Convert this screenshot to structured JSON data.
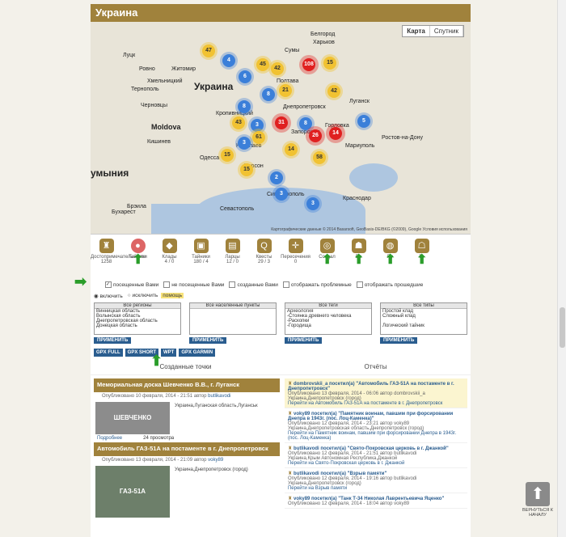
{
  "region_title": "Украина",
  "map": {
    "buttons": [
      "Карта",
      "Спутник"
    ],
    "country_labels": [
      "Украина",
      "Moldova",
      "умыния"
    ],
    "cities": [
      "Луцк",
      "Ровно",
      "Житомир",
      "Хмельницкий",
      "Тернополь",
      "Черновцы",
      "Кишинев",
      "Одесса",
      "Бухарест",
      "Брэила",
      "Севастополь",
      "Симферополь",
      "Краснодар",
      "Ростов-на-Дону",
      "Луганск",
      "Харьков",
      "Белгород",
      "Сумы",
      "Полтава",
      "Днепропетровск",
      "Запорожье",
      "Херсон",
      "Николаев",
      "Мариуполь",
      "Горловка",
      "Кропивницкий"
    ],
    "attribution": "Картографические данные © 2014 Basarsoft, GeoBasis-DE/BKG (©2009), Google  Условия использования",
    "clusters": [
      {
        "v": "47",
        "c": "y"
      },
      {
        "v": "4",
        "c": "b"
      },
      {
        "v": "6",
        "c": "b"
      },
      {
        "v": "45",
        "c": "y"
      },
      {
        "v": "42",
        "c": "y"
      },
      {
        "v": "108",
        "c": "r"
      },
      {
        "v": "15",
        "c": "y"
      },
      {
        "v": "8",
        "c": "b"
      },
      {
        "v": "21",
        "c": "y"
      },
      {
        "v": "42",
        "c": "y"
      },
      {
        "v": "8",
        "c": "b"
      },
      {
        "v": "43",
        "c": "y"
      },
      {
        "v": "3",
        "c": "b"
      },
      {
        "v": "31",
        "c": "r"
      },
      {
        "v": "61",
        "c": "y"
      },
      {
        "v": "3",
        "c": "b"
      },
      {
        "v": "8",
        "c": "b"
      },
      {
        "v": "26",
        "c": "r"
      },
      {
        "v": "14",
        "c": "r"
      },
      {
        "v": "15",
        "c": "y"
      },
      {
        "v": "15",
        "c": "y"
      },
      {
        "v": "14",
        "c": "y"
      },
      {
        "v": "58",
        "c": "y"
      },
      {
        "v": "2",
        "c": "b"
      },
      {
        "v": "3",
        "c": "b"
      },
      {
        "v": "3",
        "c": "b"
      },
      {
        "v": "5",
        "c": "b"
      }
    ]
  },
  "categories": [
    {
      "label": "Достопримечательности",
      "count": "1258",
      "icon": "♜"
    },
    {
      "label": "Тайники",
      "count": "",
      "icon": "●"
    },
    {
      "label": "Клады",
      "count": "4 / 0",
      "icon": "◆"
    },
    {
      "label": "Тайники",
      "count": "180 / 4",
      "icon": "▣"
    },
    {
      "label": "Ларцы",
      "count": "12 / 0",
      "icon": "▤"
    },
    {
      "label": "Квесты",
      "count": "29 / 3",
      "icon": "Q"
    },
    {
      "label": "Пересечения",
      "count": "0",
      "icon": "✛"
    },
    {
      "label": "Создал",
      "count": "",
      "icon": "◎"
    },
    {
      "label": "Во",
      "count": "",
      "icon": "☗"
    },
    {
      "label": "Пу",
      "count": "",
      "icon": "◍"
    },
    {
      "label": "Ге",
      "count": "",
      "icon": "☖"
    }
  ],
  "filters": [
    "посещенные Вами",
    "не посещенные Вами",
    "созданные Вами",
    "отображать проблемные",
    "отображать прошедшие"
  ],
  "mode": {
    "include": "включить",
    "exclude": "исключить",
    "help": "помощь"
  },
  "lists": [
    {
      "header": "Все регионы",
      "items": [
        "Винницкая область",
        "Волынская область",
        "Днепропетровская область",
        "Донецкая область"
      ],
      "apply": "ПРИМЕНИТЬ"
    },
    {
      "header": "Все населенные пункты",
      "items": [],
      "apply": "ПРИМЕНИТЬ"
    },
    {
      "header": "Все теги",
      "items": [
        "Археология",
        "-Стоянка древнего человека",
        "-Раскопки",
        "-Городища"
      ],
      "apply": "ПРИМЕНИТЬ"
    },
    {
      "header": "Все типы",
      "items": [
        "Простой клад",
        "Сложный клад",
        "",
        "Логический тайник"
      ],
      "apply": "ПРИМЕНИТЬ"
    }
  ],
  "gpx": [
    "GPX FULL",
    "GPX SHORT",
    "WPT",
    "GPX GARMIN"
  ],
  "sections": {
    "created": "Созданные точки",
    "reports": "Отчёты"
  },
  "points": [
    {
      "title": "Мемориальная доска Шевченко В.В., г. Луганск",
      "meta": "Опубликовано 10 февраля, 2014 - 21:51 автор",
      "author": "butlikavodi",
      "location": "Украина,Луганская область,Луганськ",
      "img": "ШЕВЧЕНКО",
      "more": "Подробнее",
      "views": "24 просмотра"
    },
    {
      "title": "Автомобиль ГАЗ-51А на постаменте в г. Днепропетровск",
      "meta": "Опубликовано 13 февраля, 2014 - 21:09 автор",
      "author": "voky89",
      "location": "Украина,Днепропетровск (город)",
      "img": "ГАЗ-51А"
    }
  ],
  "reports": [
    {
      "user": "dombrovskii_a",
      "action": "посетил(а)",
      "title": "\"Автомобиль ГАЗ-51А на постаменте в г. Днепропетровск\"",
      "meta": "Опубликовано 13 февраля, 2014 - 06:06 автор dombrovskii_a",
      "location": "Украина,Днепропетровск (город)",
      "go": "Перейти на Автомобиль ГАЗ-51А на постаменте в г. Днепропетровск",
      "hl": true
    },
    {
      "user": "voky89",
      "action": "посетил(а)",
      "title": "\"Памятник воинам, павшим при форсировании Днепра в 1943г. (пос. Лоц-Каменка)\"",
      "meta": "Опубликовано 12 февраля, 2014 - 23:21 автор voky89",
      "location": "Украина,Днепропетровская область,Днепропетровск (город)",
      "go": "Перейти на Памятник воинам, павшим при форсировании Днепра в 1943г. (пос. Лоц-Каменка)",
      "hl": false
    },
    {
      "user": "butlikavodi",
      "action": "посетил(а)",
      "title": "\"Свято-Покровская церковь в г. Джанкой\"",
      "meta": "Опубликовано 12 февраля, 2014 - 21:51 автор butlikavodi",
      "location": "Украина,Крым Автономная Республика,Джанкой",
      "go": "Перейти на Свято-Покровская церковь в г. Джанкой",
      "hl": false
    },
    {
      "user": "butlikavodi",
      "action": "посетил(а)",
      "title": "\"Взрыв памяти\"",
      "meta": "Опубликовано 12 февраля, 2014 - 19:16 автор butlikavodi",
      "location": "Украина,Днепропетровск (город)",
      "go": "Перейти на Взрыв памяти",
      "hl": false
    },
    {
      "user": "voky89",
      "action": "посетил(а)",
      "title": "\"Танк Т-34 Николая Лаврентьевича Яценко\"",
      "meta": "Опубликовано 12 февраля, 2014 - 18:04 автор voky89",
      "location": "",
      "go": "",
      "hl": false
    }
  ],
  "up_button": "ВЕРНУТЬСЯ К НАЧАЛУ"
}
